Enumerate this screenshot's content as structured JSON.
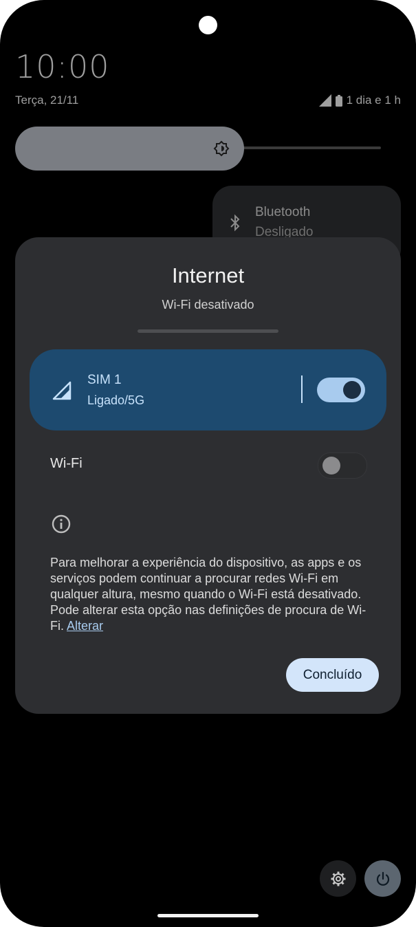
{
  "status": {
    "time": "10:00",
    "date": "Terça, 21/11",
    "battery_text": "1 dia e 1 h"
  },
  "quick_settings": {
    "bluetooth_title": "Bluetooth",
    "bluetooth_state": "Desligado"
  },
  "dialog": {
    "title": "Internet",
    "subtitle": "Wi-Fi desativado",
    "sim": {
      "name": "SIM 1",
      "status": "Ligado/5G",
      "enabled": true
    },
    "wifi": {
      "label": "Wi-Fi",
      "enabled": false
    },
    "info_text": "Para melhorar a experiência do dispositivo, as apps e os serviços podem continuar a procurar redes Wi-Fi em qualquer altura, mesmo quando o Wi-Fi está desativado. Pode alterar esta opção nas definições de procura de Wi-Fi.",
    "info_link": "Alterar",
    "done_label": "Concluído"
  },
  "colors": {
    "dialog_bg": "#2d2e31",
    "sim_card_bg": "#1d4a6f",
    "accent": "#a8cbee",
    "button_bg": "#d3e5fa"
  },
  "icons": {
    "signal": "cellular-signal-icon",
    "battery": "battery-icon",
    "brightness": "brightness-icon",
    "bluetooth": "bluetooth-icon",
    "info": "info-icon",
    "settings": "gear-icon",
    "power": "power-icon"
  }
}
